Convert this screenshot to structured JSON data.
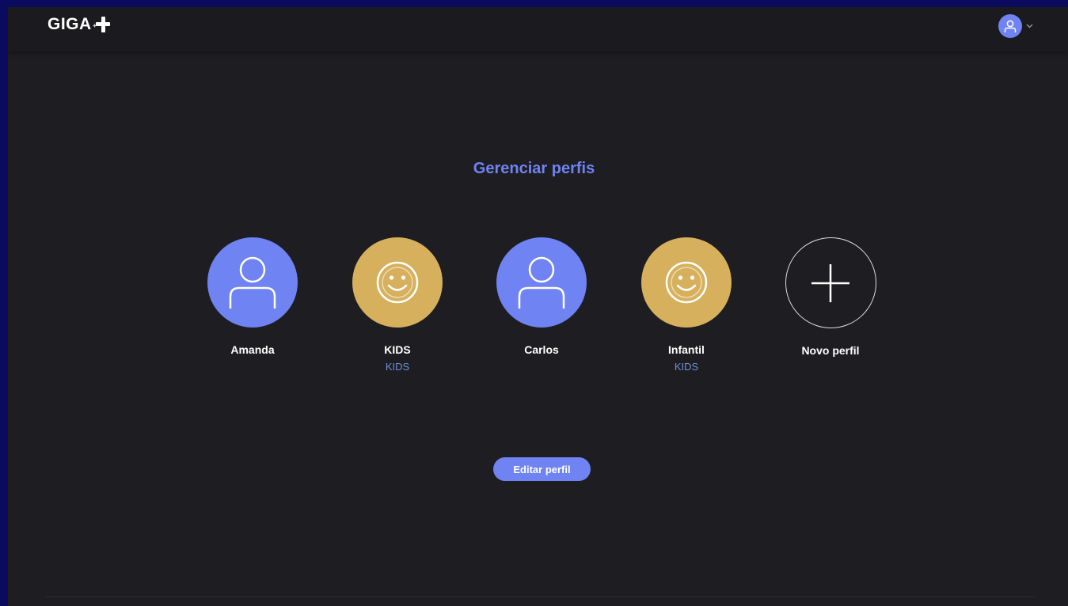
{
  "header": {
    "logo_text": "GIGA",
    "logo_icon": "plus-icon",
    "account_icon": "user-icon",
    "account_menu_icon": "chevron-down-icon"
  },
  "main": {
    "title": "Gerenciar perfis",
    "profiles": [
      {
        "name": "Amanda",
        "tag": "",
        "icon": "user-icon",
        "color": "#6f83f2"
      },
      {
        "name": "KIDS",
        "tag": "KIDS",
        "icon": "smiley-icon",
        "color": "#d6b05c"
      },
      {
        "name": "Carlos",
        "tag": "",
        "icon": "user-icon",
        "color": "#6f83f2"
      },
      {
        "name": "Infantil",
        "tag": "KIDS",
        "icon": "smiley-icon",
        "color": "#d6b05c"
      },
      {
        "name": "Novo perfil",
        "tag": "",
        "icon": "plus-icon",
        "color": "transparent"
      }
    ],
    "edit_button_label": "Editar perfil"
  },
  "theme": {
    "accent": "#6f83f2",
    "kids": "#d6b05c",
    "background": "#1e1d21"
  }
}
